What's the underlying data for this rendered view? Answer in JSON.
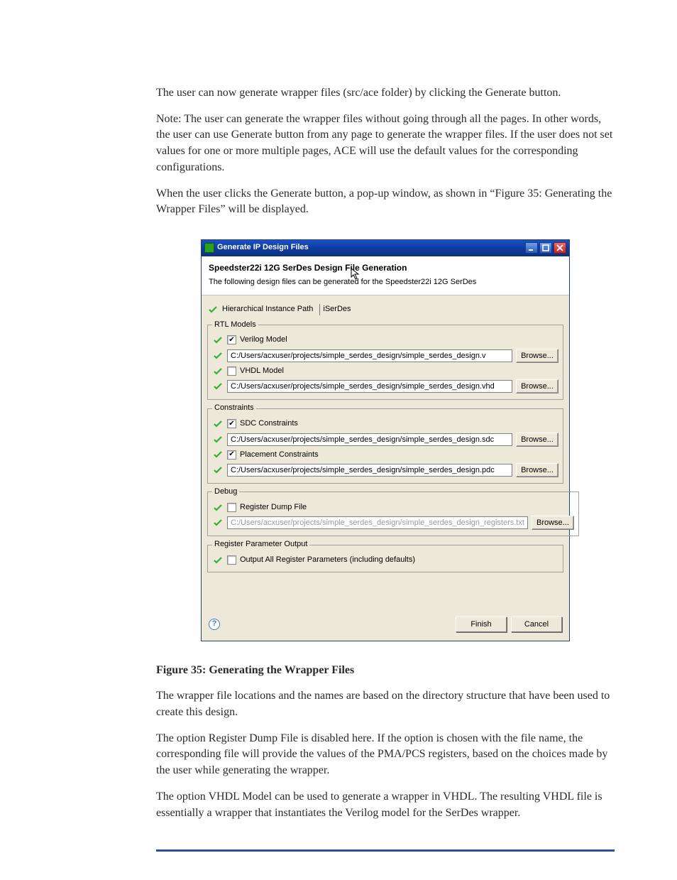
{
  "doc": {
    "p1": "The user can now generate wrapper files (src/ace folder) by clicking the Generate button.",
    "p2": "Note: The user can generate the wrapper files without going through all the pages. In other words, the user can use Generate button from any page to generate the wrapper files. If the user does not set values for one or more multiple pages, ACE will use the default values for the corresponding configurations.",
    "p3": "When the user clicks the Generate button, a pop-up window, as shown in “Figure 35: Generating the Wrapper Files” will be displayed.",
    "figcap": "Figure 35: Generating the Wrapper Files",
    "p4": "The wrapper file locations and the names are based on the directory structure that have been used to create this design.",
    "p5": "The option Register Dump File is disabled here. If the option is chosen with the file name, the corresponding file will provide the values of the PMA/PCS registers, based on the choices made by the user while generating the wrapper.",
    "p6": "The option VHDL Model can be used to generate a wrapper in VHDL. The resulting VHDL file is essentially a wrapper that instantiates the Verilog model for the SerDes wrapper."
  },
  "dlg": {
    "title": "Generate IP Design Files",
    "header": "Speedster22i 12G SerDes Design File Generation",
    "subheader": "The following design files can be generated for the Speedster22i 12G SerDes",
    "hpath_label": "Hierarchical Instance Path",
    "hpath_value": "iSerDes",
    "grp_rtl": "RTL Models",
    "verilog_label": "Verilog Model",
    "verilog_path": "C:/Users/acxuser/projects/simple_serdes_design/simple_serdes_design.v",
    "vhdl_label": "VHDL Model",
    "vhdl_path": "C:/Users/acxuser/projects/simple_serdes_design/simple_serdes_design.vhd",
    "grp_con": "Constraints",
    "sdc_label": "SDC Constraints",
    "sdc_path": "C:/Users/acxuser/projects/simple_serdes_design/simple_serdes_design.sdc",
    "plc_label": "Placement Constraints",
    "plc_path": "C:/Users/acxuser/projects/simple_serdes_design/simple_serdes_design.pdc",
    "grp_dbg": "Debug",
    "dump_label": "Register Dump File",
    "dump_path": "C:/Users/acxuser/projects/simple_serdes_design/simple_serdes_design_registers.txt",
    "grp_reg": "Register Parameter Output",
    "outall_label": "Output All Register Parameters (including defaults)",
    "browse": "Browse...",
    "finish": "Finish",
    "cancel": "Cancel"
  }
}
